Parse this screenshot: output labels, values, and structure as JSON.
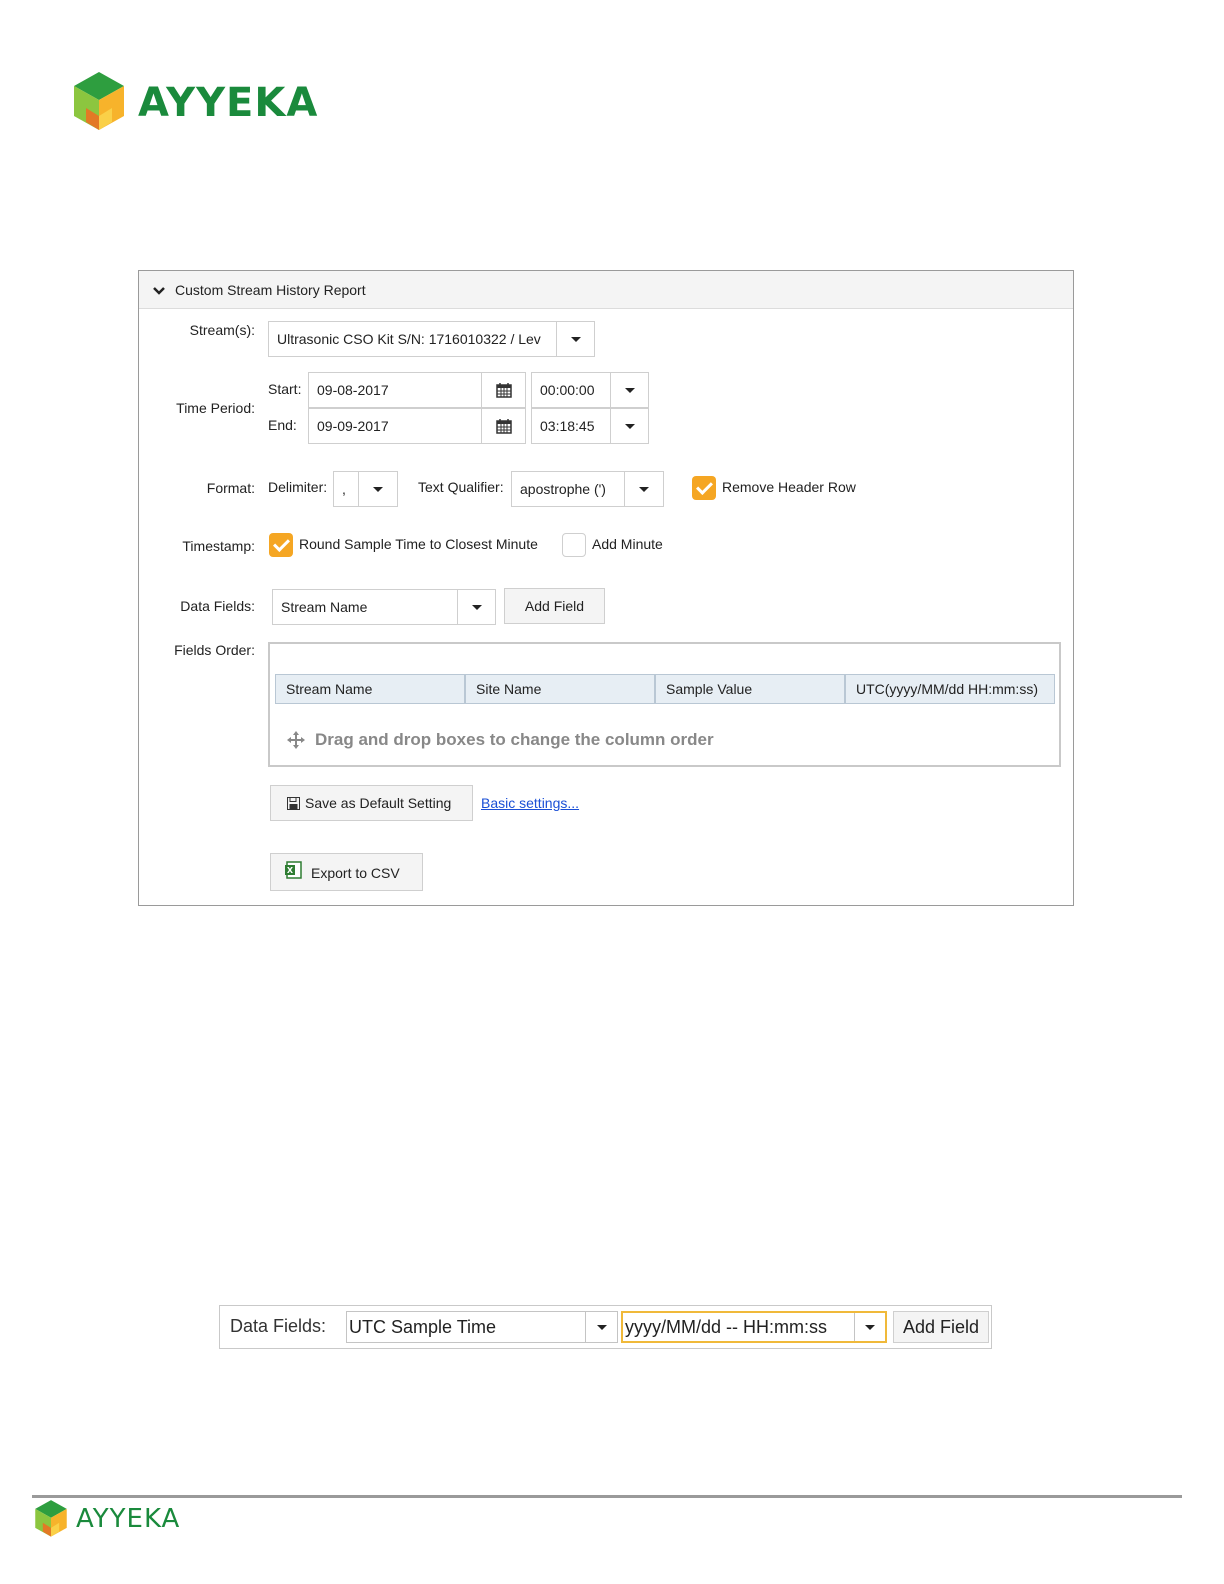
{
  "header": {
    "brand": "AYYEKA"
  },
  "report": {
    "title": "Custom Stream History Report",
    "streams_label": "Stream(s):",
    "streams_value": "Ultrasonic CSO Kit S/N: 1716010322 / Lev",
    "time_period_label": "Time Period:",
    "start_label": "Start:",
    "start_date": "09-08-2017",
    "start_time": "00:00:00",
    "end_label": "End:",
    "end_date": "09-09-2017",
    "end_time": "03:18:45",
    "format_label": "Format:",
    "delimiter_label": "Delimiter:",
    "delimiter_value": ",",
    "text_qualifier_label": "Text Qualifier:",
    "text_qualifier_value": "apostrophe (')",
    "remove_header_label": "Remove Header Row",
    "remove_header_checked": true,
    "timestamp_label": "Timestamp:",
    "round_label": "Round Sample Time to Closest Minute",
    "round_checked": true,
    "add_minute_label": "Add Minute",
    "add_minute_checked": false,
    "data_fields_label": "Data Fields:",
    "data_fields_value": "Stream Name",
    "add_field_label": "Add Field",
    "fields_order_label": "Fields Order:",
    "columns": [
      "Stream Name",
      "Site Name",
      "Sample Value",
      "UTC(yyyy/MM/dd HH:mm:ss)"
    ],
    "drag_hint": "Drag and drop boxes to change the column order",
    "save_default_label": "Save as Default Setting",
    "basic_settings_link": "Basic settings...",
    "export_label": "Export to CSV"
  },
  "data_fields_bar": {
    "label": "Data Fields:",
    "field_value": "UTC Sample Time",
    "format_value": "yyyy/MM/dd  -- HH:mm:ss",
    "add_field_label": "Add Field"
  },
  "footer": {
    "brand": "AYYEKA"
  },
  "colors": {
    "brand_green": "#1a8a3c",
    "checkbox_orange": "#f5a623",
    "link_blue": "#1a4fd6"
  }
}
